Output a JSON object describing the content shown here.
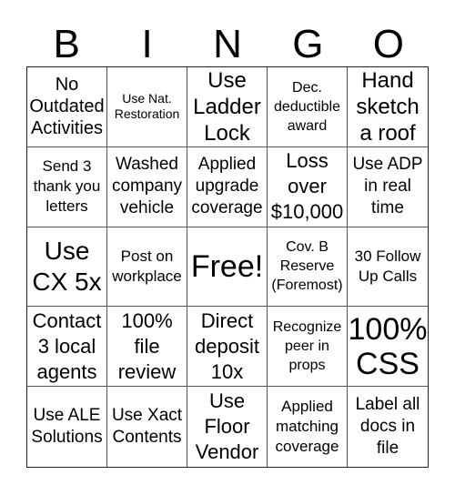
{
  "header": {
    "letters": [
      "B",
      "I",
      "N",
      "G",
      "O"
    ]
  },
  "cells": [
    "No Outdated Activities",
    "Use Nat. Restoration",
    "Use Ladder Lock",
    "Dec. deductible award",
    "Hand sketch a roof",
    "Send 3 thank you letters",
    "Washed company vehicle",
    "Applied upgrade coverage",
    "Loss over $10,000",
    "Use ADP in real time",
    "Use CX 5x",
    "Post on workplace",
    "Free!",
    "Cov. B Reserve (Foremost)",
    "30 Follow Up Calls",
    "Contact 3 local agents",
    "100% file review",
    "Direct deposit 10x",
    "Recognize peer in props",
    "100% CSS",
    "Use ALE Solutions",
    "Use Xact Contents",
    "Use Floor Vendor",
    "Applied matching coverage",
    "Label all docs in file"
  ],
  "free_space_index": 12
}
